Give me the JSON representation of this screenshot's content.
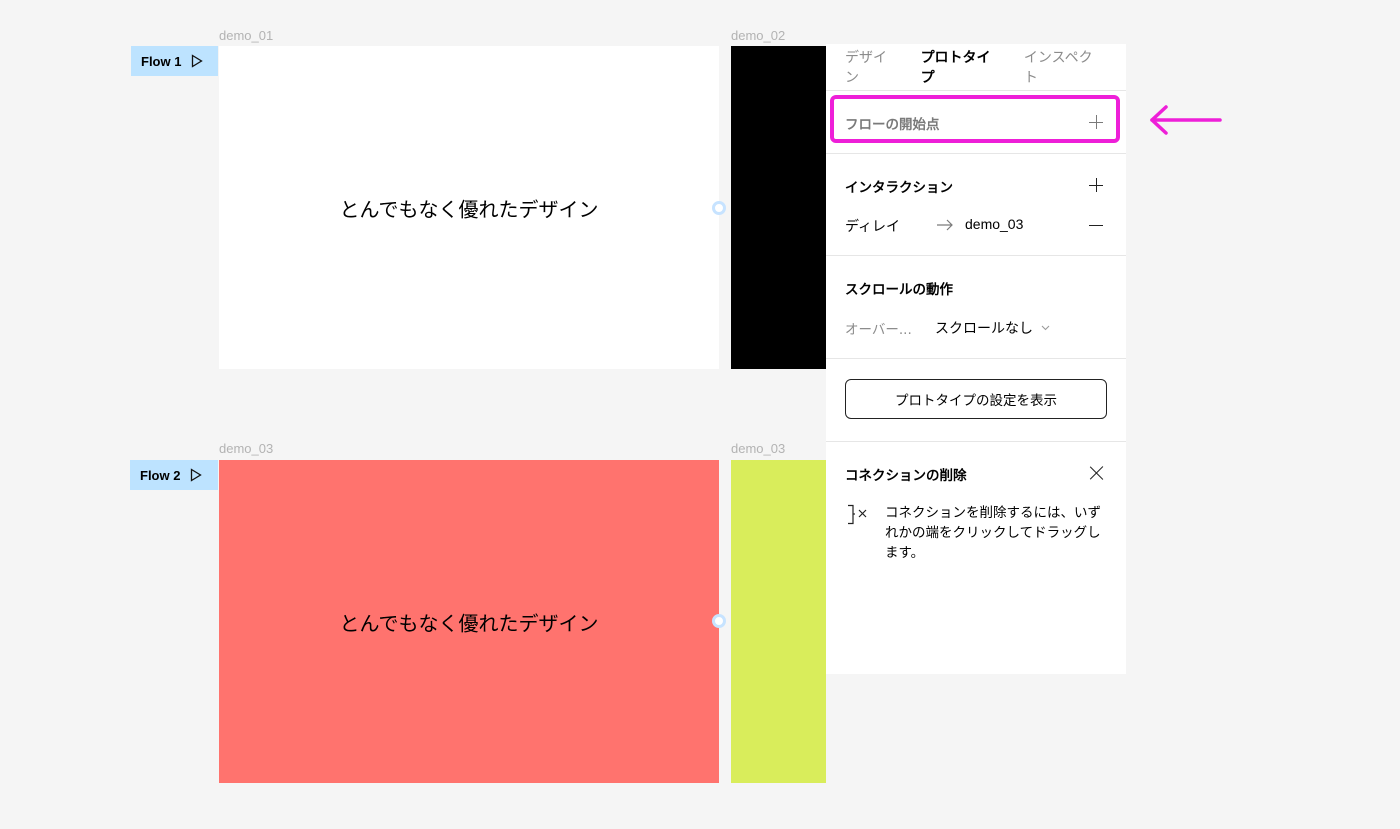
{
  "canvas": {
    "frames": [
      {
        "label": "demo_01",
        "text": "とんでもなく優れたデザイン",
        "color": "#ffffff"
      },
      {
        "label": "demo_02",
        "color": "#000000"
      },
      {
        "label": "demo_03",
        "text": "とんでもなく優れたデザイン",
        "color": "#ff736e"
      },
      {
        "label": "demo_03",
        "color": "#d9ed5b"
      }
    ],
    "flows": [
      {
        "label": "Flow 1",
        "icon": "play-icon"
      },
      {
        "label": "Flow 2",
        "icon": "play-icon"
      }
    ]
  },
  "panel": {
    "tabs": [
      {
        "label": "デザイン",
        "active": false
      },
      {
        "label": "プロトタイプ",
        "active": true
      },
      {
        "label": "インスペクト",
        "active": false
      }
    ],
    "flow_start": {
      "label": "フローの開始点",
      "icon": "plus-icon"
    },
    "interactions": {
      "title": "インタラクション",
      "trigger": "ディレイ",
      "target": "demo_03",
      "add_icon": "plus-icon",
      "remove_icon": "minus-icon"
    },
    "scroll": {
      "title": "スクロールの動作",
      "overflow_label": "オーバー...",
      "overflow_value": "スクロールなし",
      "dropdown_icon": "chevron-down-icon"
    },
    "settings_button": "プロトタイプの設定を表示",
    "delete_connection": {
      "title": "コネクションの削除",
      "description": "コネクションを削除するには、いずれかの端をクリックしてドラッグします。",
      "close_icon": "close-icon",
      "hint_icon": "disconnect-icon"
    }
  },
  "annotation": {
    "arrow_icon": "arrow-left-icon",
    "color": "#ee1fd8"
  },
  "colors": {
    "flow_tag": "#bde3ff",
    "connection_node": "#c7e3ff",
    "highlight": "#ee1fd8"
  }
}
